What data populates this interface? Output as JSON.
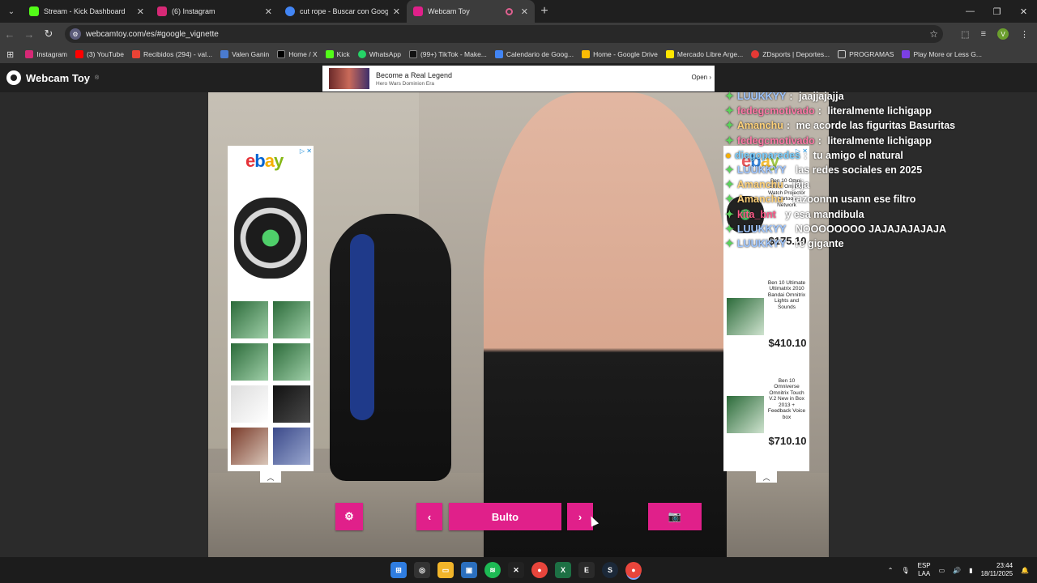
{
  "browser": {
    "tabs": [
      {
        "title": "Stream - Kick Dashboard",
        "color": "#53fc18",
        "active": false
      },
      {
        "title": "(6) Instagram",
        "color": "#d62976",
        "active": false
      },
      {
        "title": "cut rope - Buscar con Google",
        "color": "#4285f4",
        "active": false
      },
      {
        "title": "Webcam Toy",
        "color": "#e0208a",
        "active": true
      }
    ],
    "url": "webcamtoy.com/es/#google_vignette",
    "profile_initial": "V",
    "bookmarks": [
      {
        "label": "Instagram",
        "color": "#d62976"
      },
      {
        "label": "(3) YouTube",
        "color": "#ff0000"
      },
      {
        "label": "Recibidos (294) - val...",
        "color": "#ea4335"
      },
      {
        "label": "Valen Ganin",
        "color": "#4a7bd0"
      },
      {
        "label": "Home / X",
        "color": "#000000"
      },
      {
        "label": "Kick",
        "color": "#53fc18"
      },
      {
        "label": "WhatsApp",
        "color": "#25d366"
      },
      {
        "label": "(99+) TikTok - Make...",
        "color": "#111111"
      },
      {
        "label": "Calendario de Goog...",
        "color": "#4285f4"
      },
      {
        "label": "Home - Google Drive",
        "color": "#fbbc04"
      },
      {
        "label": "Mercado Libre Arge...",
        "color": "#ffe600"
      },
      {
        "label": "ZDsports | Deportes...",
        "color": "#e53935"
      },
      {
        "label": "PROGRAMAS",
        "color": "#8a8a8a"
      },
      {
        "label": "Play More or Less G...",
        "color": "#7b3fe4"
      }
    ]
  },
  "site": {
    "logo": "Webcam Toy",
    "logo_mark": "®",
    "top_ad": {
      "headline": "Become a Real Legend",
      "sub": "Hero Wars Dominion Era",
      "cta": "Open"
    }
  },
  "left_ad": {
    "brand_e": "e",
    "brand_b": "b",
    "brand_a": "a",
    "brand_y": "y",
    "adchoice": "▷ ✕"
  },
  "right_ad": {
    "products": [
      {
        "name": "Ben 10 Ultimate Ultimatrix 2010 Bandai Omnitrix Lights and Sounds",
        "price": "$410.10"
      },
      {
        "name": "Ben 10 Omniverse Omnitrix Touch V.2 New in Box 2013 + Feedback Voice box",
        "price": "$710.10"
      }
    ],
    "overlap_name": "Ben 10 Omni-Strike Omnitrix Watch Projector Cartoon Network",
    "overlap_price": "$175.10"
  },
  "chat": [
    {
      "user": "LUUKKYY",
      "text": "jaajjajajja",
      "color": "#9fc6ff"
    },
    {
      "user": "fedegcmotivado",
      "text": "literalmente lichigapp",
      "color": "#ff7aa8"
    },
    {
      "user": "Amanchu",
      "text": "me acorde las figuritas Basuritas",
      "color": "#ffd27a"
    },
    {
      "user": "fedegcmotivado",
      "text": "literalmente lichigapp",
      "color": "#ff7aa8"
    },
    {
      "user": "diegoparedes",
      "text": "tu amigo el natural",
      "color": "#7ad0ff"
    },
    {
      "user": "LUUKKYY",
      "text": "las redes sociales en 2025",
      "color": "#9fc6ff"
    },
    {
      "user": "Amanchu",
      "text": "jaja",
      "color": "#ffd27a"
    },
    {
      "user": "Amanchu",
      "text": "razoonnn usann ese filtro",
      "color": "#ffd27a"
    },
    {
      "user": "kita_bnt",
      "text": "y esa mandibula",
      "color": "#ff5a8a"
    },
    {
      "user": "LUUKKYY",
      "text": "NOOOOOOOO JAJAJAJAJAJA",
      "color": "#9fc6ff"
    },
    {
      "user": "LUUKKYY",
      "text": "re gigante",
      "color": "#9fc6ff"
    }
  ],
  "controls": {
    "effect_label": "Bulto",
    "accent": "#e0208a"
  },
  "taskbar": {
    "lang_top": "ESP",
    "lang_bottom": "LAA",
    "time": "23:44",
    "date": "18/11/2025",
    "apps": [
      "win",
      "copilot",
      "files",
      "store",
      "spotify",
      "xbox",
      "chrome",
      "excel",
      "epic",
      "steam",
      "chrome-active"
    ]
  }
}
